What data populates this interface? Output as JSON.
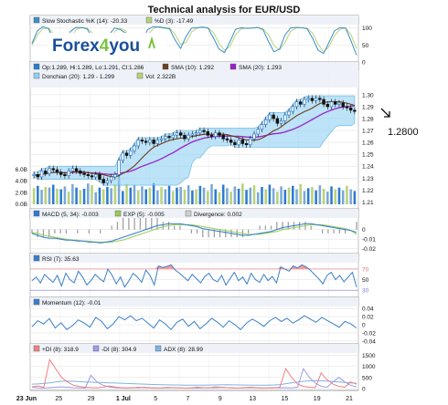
{
  "title": "Technical analysis for EUR/USD",
  "logo": {
    "text_a": "Forex",
    "text_b": "4",
    "text_c": "you"
  },
  "annotation": {
    "price": "1.2800",
    "arrow_icon": "arrow-down-right-icon"
  },
  "colors": {
    "up_candle": "#2b7bd0",
    "down_candle": "#111111",
    "sma10": "#6b3e1e",
    "sma20": "#9b20c8",
    "donchian": "#8fd0f2",
    "stoch_k": "#3a8ec8",
    "stoch_d": "#b9d27a",
    "rsi_fill": "#f59a9a",
    "panel_blue": "#3a7fc8",
    "pdi": "#f08080",
    "ndi": "#9d9de8",
    "adx": "#7fb4e0"
  },
  "chart_data": [
    {
      "type": "line",
      "name": "stochastic",
      "legend": [
        "Slow Stochastic %K (14): -20.33",
        "%D (3): -17.49"
      ],
      "yticks": [
        "100",
        "50",
        "0"
      ],
      "ylim": [
        0,
        110
      ],
      "series": [
        {
          "name": "%K",
          "values": [
            55,
            92,
            104,
            98,
            60,
            35,
            48,
            90,
            102,
            101,
            98,
            70,
            30,
            42,
            80,
            100,
            96,
            85,
            40,
            20,
            55,
            95,
            104,
            103,
            100,
            98,
            65,
            40,
            75,
            100,
            101,
            103,
            100,
            70,
            38,
            28,
            60,
            96,
            101,
            99,
            100,
            102,
            95,
            60,
            30,
            38,
            80,
            100,
            102,
            101,
            98,
            70,
            35,
            25,
            58,
            92,
            101,
            100,
            62,
            20
          ]
        },
        {
          "name": "%D",
          "values": [
            50,
            80,
            98,
            100,
            80,
            50,
            40,
            70,
            95,
            102,
            100,
            85,
            50,
            38,
            62,
            90,
            99,
            92,
            62,
            32,
            40,
            78,
            98,
            104,
            102,
            100,
            82,
            52,
            58,
            88,
            100,
            102,
            101,
            86,
            55,
            35,
            45,
            80,
            97,
            100,
            100,
            101,
            98,
            80,
            48,
            36,
            58,
            90,
            100,
            101,
            100,
            85,
            52,
            30,
            45,
            78,
            96,
            100,
            80,
            40
          ]
        }
      ]
    },
    {
      "type": "candlestick",
      "name": "price",
      "legend": [
        "Op:1.289, Hi:1.289, Lo:1.291, Cl:1.286",
        "SMA (10): 1.292",
        "SMA (20): 1.293",
        "Donchian (20): 1.29 - 1.299",
        "Vol: 2.322B"
      ],
      "yticks": [
        "1.30",
        "1.29",
        "1.28",
        "1.27",
        "1.26",
        "1.25",
        "1.24",
        "1.23",
        "1.22",
        "1.21"
      ],
      "volume_ticks": [
        "6.0B",
        "4.0B",
        "2.0B",
        "0.0B"
      ],
      "ylim": [
        1.208,
        1.306
      ],
      "xticks": [
        "23 Jun",
        "25",
        "29",
        "1 Jul",
        "5",
        "7",
        "9",
        "13",
        "15",
        "19",
        "21"
      ],
      "close": [
        1.233,
        1.231,
        1.236,
        1.234,
        1.238,
        1.237,
        1.235,
        1.233,
        1.232,
        1.236,
        1.238,
        1.236,
        1.234,
        1.233,
        1.232,
        1.231,
        1.233,
        1.229,
        1.226,
        1.228,
        1.231,
        1.233,
        1.245,
        1.251,
        1.249,
        1.253,
        1.257,
        1.262,
        1.261,
        1.26,
        1.262,
        1.259,
        1.262,
        1.263,
        1.265,
        1.264,
        1.266,
        1.268,
        1.266,
        1.263,
        1.266,
        1.267,
        1.268,
        1.27,
        1.269,
        1.266,
        1.265,
        1.268,
        1.266,
        1.263,
        1.262,
        1.26,
        1.258,
        1.262,
        1.259,
        1.258,
        1.263,
        1.267,
        1.271,
        1.275,
        1.279,
        1.283,
        1.28,
        1.276,
        1.278,
        1.283,
        1.286,
        1.29,
        1.294,
        1.292,
        1.296,
        1.297,
        1.295,
        1.297,
        1.296,
        1.292,
        1.29,
        1.294,
        1.292,
        1.293,
        1.29,
        1.289,
        1.287,
        1.286
      ],
      "volume": [
        2.8,
        3.2,
        2.5,
        3.0,
        2.9,
        3.4,
        2.7,
        2.6,
        3.1,
        2.2,
        3.5,
        2.9,
        2.4,
        2.7,
        3.6,
        3.3,
        2.1,
        2.9,
        2.6,
        3.0,
        2.8,
        3.4,
        4.6,
        2.3,
        3.5,
        2.9,
        3.3,
        2.4,
        3.1,
        2.6,
        2.9,
        3.7,
        2.4,
        3.0,
        2.6,
        3.2,
        2.3,
        2.9,
        3.0,
        2.5,
        3.3,
        2.4,
        2.6,
        3.2,
        2.9,
        2.3,
        3.5,
        2.6,
        2.1,
        3.4,
        2.8,
        2.2,
        3.1,
        2.7,
        3.6,
        2.5,
        2.9,
        3.3,
        2.1,
        3.0,
        2.6,
        3.4,
        2.8,
        2.2,
        3.1,
        2.5,
        2.9,
        3.2,
        2.6,
        3.5,
        2.3,
        2.8,
        3.0,
        2.4,
        3.3,
        2.7,
        2.2,
        3.1,
        2.6,
        2.9,
        2.4,
        3.2,
        2.6,
        2.3
      ]
    },
    {
      "type": "line",
      "name": "macd",
      "legend": [
        "MACD (5, 34): -0.003",
        "EXP (5): -0.005",
        "Divergence: 0.002"
      ],
      "yticks": [
        "0",
        "-0.01",
        "-0.02"
      ],
      "ylim": [
        -0.025,
        0.012
      ],
      "series": [
        {
          "name": "MACD",
          "values": [
            -0.004,
            -0.006,
            -0.008,
            -0.009,
            -0.009,
            -0.01,
            -0.011,
            -0.011,
            -0.012,
            -0.012,
            -0.013,
            -0.013,
            -0.014,
            -0.013,
            -0.012,
            -0.01,
            -0.008,
            -0.006,
            -0.004,
            -0.002,
            0.0,
            0.002,
            0.004,
            0.005,
            0.006,
            0.006,
            0.006,
            0.005,
            0.004,
            0.003,
            0.001,
            0.0,
            -0.001,
            -0.002,
            -0.003,
            -0.004,
            -0.005,
            -0.006,
            -0.006,
            -0.005,
            -0.004,
            -0.003,
            -0.002,
            0.0,
            0.002,
            0.003,
            0.004,
            0.005,
            0.006,
            0.006,
            0.005,
            0.004,
            0.003,
            0.002,
            0.001,
            0.0,
            -0.001,
            -0.003
          ]
        },
        {
          "name": "EXP",
          "values": [
            -0.003,
            -0.004,
            -0.006,
            -0.007,
            -0.008,
            -0.009,
            -0.01,
            -0.011,
            -0.011,
            -0.012,
            -0.012,
            -0.013,
            -0.013,
            -0.013,
            -0.013,
            -0.012,
            -0.011,
            -0.009,
            -0.007,
            -0.005,
            -0.003,
            -0.001,
            0.001,
            0.003,
            0.004,
            0.005,
            0.005,
            0.005,
            0.005,
            0.004,
            0.003,
            0.002,
            0.001,
            0.0,
            -0.001,
            -0.002,
            -0.003,
            -0.004,
            -0.005,
            -0.005,
            -0.005,
            -0.004,
            -0.003,
            -0.002,
            0.0,
            0.001,
            0.002,
            0.003,
            0.004,
            0.005,
            0.005,
            0.005,
            0.004,
            0.003,
            0.002,
            0.001,
            -0.001,
            -0.005
          ]
        }
      ]
    },
    {
      "type": "line",
      "name": "rsi",
      "legend": [
        "RSI (7): 35.63"
      ],
      "yticks": [
        "70",
        "50",
        "30"
      ],
      "ylim": [
        20,
        82
      ],
      "series": [
        {
          "name": "RSI",
          "values": [
            48,
            55,
            44,
            60,
            52,
            45,
            58,
            38,
            62,
            50,
            44,
            66,
            55,
            40,
            48,
            60,
            52,
            46,
            70,
            58,
            42,
            55,
            36,
            48,
            62,
            55,
            45,
            68,
            58,
            40,
            76,
            73,
            75,
            78,
            68,
            62,
            55,
            48,
            60,
            52,
            44,
            56,
            62,
            50,
            46,
            58,
            40,
            52,
            64,
            48,
            55,
            42,
            62,
            50,
            45,
            60,
            48,
            56,
            44,
            74,
            70,
            66,
            76,
            72,
            78,
            74,
            68,
            60,
            52,
            42,
            58,
            64,
            50,
            58,
            46,
            55,
            64,
            36
          ]
        }
      ]
    },
    {
      "type": "line",
      "name": "momentum",
      "legend": [
        "Momentum (12): -0.01"
      ],
      "yticks": [
        "0.04",
        "0.02",
        "0",
        "-0.02",
        "-0.04"
      ],
      "ylim": [
        -0.045,
        0.045
      ],
      "series": [
        {
          "name": "Momentum",
          "values": [
            -0.005,
            0.01,
            0.002,
            0.015,
            -0.008,
            0.005,
            -0.012,
            -0.002,
            0.012,
            0.004,
            -0.006,
            0.018,
            0.008,
            -0.01,
            0.002,
            0.02,
            0.012,
            0.022,
            0.01,
            0.016,
            0.004,
            -0.008,
            0.012,
            0.002,
            -0.012,
            0.006,
            0.014,
            -0.004,
            0.008,
            -0.01,
            0.002,
            0.016,
            0.006,
            -0.006,
            0.01,
            0.0,
            -0.012,
            0.004,
            0.014,
            0.006,
            -0.004,
            0.01,
            0.018,
            0.008,
            0.016,
            0.004,
            0.012,
            0.022,
            0.014,
            0.006,
            0.018,
            0.01,
            0.002,
            -0.006,
            0.008,
            0.002,
            -0.008
          ]
        }
      ]
    },
    {
      "type": "line",
      "name": "adx",
      "legend": [
        "+DI (8): 318.9",
        "-DI (8): 304.9",
        "ADX (8): 28.99"
      ],
      "yticks": [
        "1500",
        "1000",
        "500",
        "0"
      ],
      "ylim": [
        0,
        1600
      ],
      "series": [
        {
          "name": "+DI",
          "values": [
            80,
            120,
            60,
            1300,
            900,
            500,
            300,
            150,
            100,
            60,
            40,
            30,
            60,
            120,
            80,
            40,
            30,
            30,
            60,
            40,
            30,
            20,
            30,
            50,
            40,
            30,
            20,
            30,
            60,
            40,
            30,
            80,
            60,
            40,
            30,
            20,
            40,
            60,
            40,
            30,
            20,
            30,
            60,
            900,
            500,
            200,
            100,
            60,
            40,
            700,
            400,
            200,
            100,
            60,
            300,
            200
          ]
        },
        {
          "name": "-DI",
          "values": [
            60,
            30,
            20,
            40,
            60,
            80,
            60,
            40,
            30,
            20,
            600,
            300,
            150,
            80,
            40,
            30,
            20,
            40,
            30,
            60,
            40,
            30,
            20,
            30,
            40,
            30,
            20,
            30,
            20,
            30,
            40,
            30,
            50,
            40,
            30,
            20,
            30,
            40,
            30,
            20,
            30,
            40,
            30,
            40,
            30,
            60,
            900,
            500,
            250,
            100,
            60,
            300,
            500,
            300,
            150,
            80
          ]
        },
        {
          "name": "ADX",
          "values": [
            200,
            210,
            230,
            260,
            300,
            330,
            340,
            330,
            310,
            300,
            290,
            280,
            270,
            260,
            250,
            240,
            230,
            220,
            210,
            200,
            190,
            180,
            175,
            170,
            165,
            160,
            155,
            150,
            150,
            155,
            160,
            165,
            170,
            175,
            170,
            165,
            160,
            155,
            150,
            150,
            155,
            165,
            180,
            220,
            260,
            300,
            330,
            350,
            360,
            350,
            340,
            320,
            300,
            280,
            260,
            240
          ]
        }
      ]
    }
  ]
}
